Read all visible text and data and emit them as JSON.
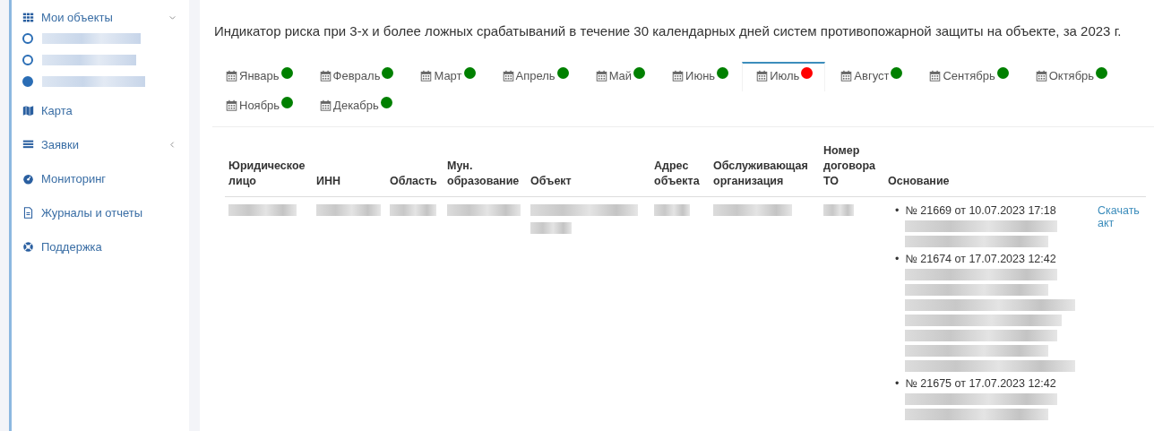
{
  "sidebar": {
    "items": [
      {
        "kind": "group",
        "label": "Мои объекты",
        "expanded": true,
        "children": [
          {
            "selected": false
          },
          {
            "selected": false
          },
          {
            "selected": true
          }
        ]
      },
      {
        "kind": "link",
        "label": "Карта"
      },
      {
        "kind": "group",
        "label": "Заявки",
        "expanded": false
      },
      {
        "kind": "link",
        "label": "Мониторинг"
      },
      {
        "kind": "link",
        "label": "Журналы и отчеты"
      },
      {
        "kind": "link",
        "label": "Поддержка"
      }
    ]
  },
  "title": "Индикатор риска при 3-х и более ложных срабатываний в течение 30 календарных дней систем противопожарной защиты на объекте, за 2023 г.",
  "tabs": [
    {
      "label": "Январь",
      "color": "#008000",
      "selected": false
    },
    {
      "label": "Февраль",
      "color": "#008000",
      "selected": false
    },
    {
      "label": "Март",
      "color": "#008000",
      "selected": false
    },
    {
      "label": "Апрель",
      "color": "#008000",
      "selected": false
    },
    {
      "label": "Май",
      "color": "#008000",
      "selected": false
    },
    {
      "label": "Июнь",
      "color": "#008000",
      "selected": false
    },
    {
      "label": "Июль",
      "color": "#ff0000",
      "selected": true
    },
    {
      "label": "Август",
      "color": "#008000",
      "selected": false
    },
    {
      "label": "Сентябрь",
      "color": "#008000",
      "selected": false
    },
    {
      "label": "Октябрь",
      "color": "#008000",
      "selected": false
    },
    {
      "label": "Ноябрь",
      "color": "#008000",
      "selected": false
    },
    {
      "label": "Декабрь",
      "color": "#008000",
      "selected": false
    }
  ],
  "table": {
    "columns": [
      "Юридическое лицо",
      "ИНН",
      "Область",
      "Мун. образование",
      "Объект",
      "Адрес объекта",
      "Обслуживающая организация",
      "Номер договора ТО",
      "Основание"
    ],
    "rows": [
      {
        "cells": [
          {
            "kind": "redacted"
          },
          {
            "kind": "redacted"
          },
          {
            "kind": "redacted"
          },
          {
            "kind": "redacted"
          },
          {
            "kind": "redacted2"
          },
          {
            "kind": "redacted"
          },
          {
            "kind": "redacted"
          },
          {
            "kind": "redacted"
          }
        ],
        "basis": [
          {
            "marker": "•",
            "text": "№ 21669 от 10.07.2023 17:18",
            "details": [
              {
                "kind": "redacted"
              },
              {
                "kind": "redacted"
              }
            ]
          },
          {
            "marker": "•",
            "text": "№ 21674 от 17.07.2023 12:42",
            "details": [
              {
                "kind": "redacted"
              },
              {
                "kind": "redacted"
              },
              {
                "kind": "redacted"
              },
              {
                "kind": "redacted"
              },
              {
                "kind": "redacted"
              },
              {
                "kind": "redacted"
              },
              {
                "kind": "redacted"
              }
            ]
          },
          {
            "marker": "•",
            "text": "№ 21675 от 17.07.2023 12:42",
            "details": [
              {
                "kind": "redacted"
              },
              {
                "kind": "redacted"
              }
            ]
          }
        ],
        "action": "Скачать акт"
      }
    ]
  }
}
